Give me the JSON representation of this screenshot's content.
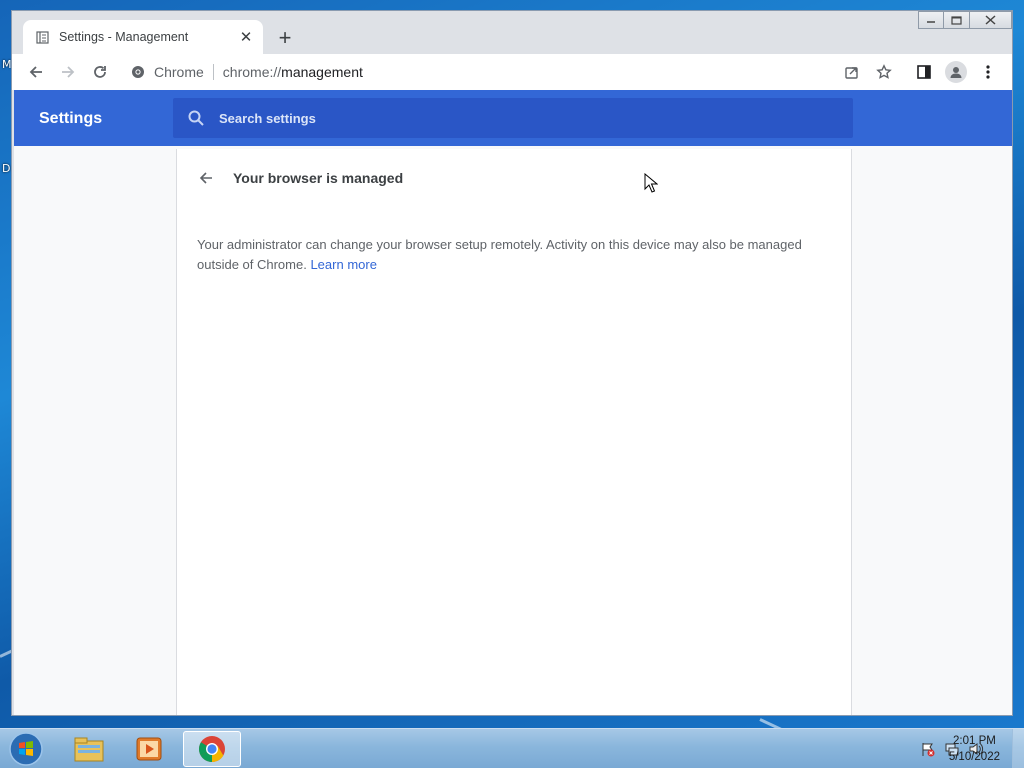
{
  "browser": {
    "tab_title": "Settings - Management",
    "omnibox_site": "Chrome",
    "omnibox_url_prefix": "chrome://",
    "omnibox_url_host": "management"
  },
  "settings": {
    "header_title": "Settings",
    "search_placeholder": "Search settings"
  },
  "management": {
    "page_title": "Your browser is managed",
    "description": "Your administrator can change your browser setup remotely. Activity on this device may also be managed outside of Chrome. ",
    "learn_more": "Learn more"
  },
  "taskbar": {
    "time": "2:01 PM",
    "date": "5/10/2022"
  },
  "colors": {
    "settings_header": "#3367d6",
    "search_box": "#2a56c6",
    "link": "#3367d6"
  }
}
